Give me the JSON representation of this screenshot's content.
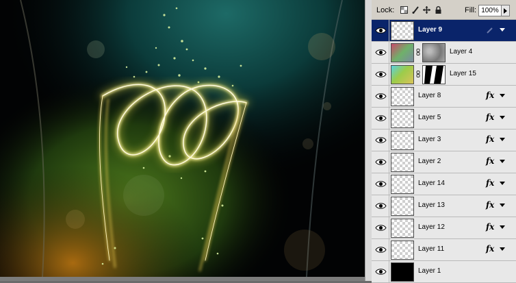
{
  "panel": {
    "lock_label": "Lock:",
    "fill_label": "Fill:",
    "fill_value": "100%"
  },
  "layers": [
    {
      "name": "Layer 9",
      "selected": true,
      "thumb": "transparent",
      "mask": null,
      "fx": false,
      "brush_icon": true
    },
    {
      "name": "Layer 4",
      "selected": false,
      "thumb": "image",
      "mask": "gray",
      "fx": false
    },
    {
      "name": "Layer 15",
      "selected": false,
      "thumb": "image",
      "mask": "bw",
      "fx": false
    },
    {
      "name": "Layer 8",
      "selected": false,
      "thumb": "transparent",
      "mask": null,
      "fx": true
    },
    {
      "name": "Layer 5",
      "selected": false,
      "thumb": "transparent",
      "mask": null,
      "fx": true
    },
    {
      "name": "Layer 3",
      "selected": false,
      "thumb": "transparent",
      "mask": null,
      "fx": true
    },
    {
      "name": "Layer 2",
      "selected": false,
      "thumb": "transparent",
      "mask": null,
      "fx": true
    },
    {
      "name": "Layer 14",
      "selected": false,
      "thumb": "transparent",
      "mask": null,
      "fx": true
    },
    {
      "name": "Layer 13",
      "selected": false,
      "thumb": "transparent",
      "mask": null,
      "fx": true
    },
    {
      "name": "Layer 12",
      "selected": false,
      "thumb": "transparent",
      "mask": null,
      "fx": true
    },
    {
      "name": "Layer 11",
      "selected": false,
      "thumb": "transparent",
      "mask": null,
      "fx": true
    },
    {
      "name": "Layer 1",
      "selected": false,
      "thumb": "black",
      "mask": null,
      "fx": false
    }
  ],
  "fx_label": "fx",
  "colors": {
    "selection": "#0a246a",
    "glow": "#f6e98a",
    "bg_teal": "#0f4a48"
  }
}
